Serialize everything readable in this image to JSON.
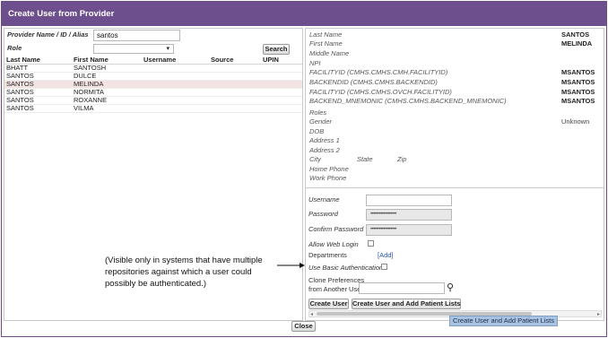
{
  "dialog": {
    "title": "Create User from Provider",
    "close_button": "Close"
  },
  "search": {
    "provider_label": "Provider Name / ID / Alias",
    "provider_value": "santos",
    "role_label": "Role",
    "role_selected": "",
    "search_button": "Search"
  },
  "results": {
    "columns": [
      "Last Name",
      "First Name",
      "Username",
      "Source",
      "UPIN"
    ],
    "rows": [
      {
        "last": "BHATT",
        "first": "SANTOSH",
        "username": "",
        "source": "",
        "upin": ""
      },
      {
        "last": "SANTOS",
        "first": "DULCE",
        "username": "",
        "source": "",
        "upin": ""
      },
      {
        "last": "SANTOS",
        "first": "MELINDA",
        "username": "",
        "source": "",
        "upin": ""
      },
      {
        "last": "SANTOS",
        "first": "NORMITA",
        "username": "",
        "source": "",
        "upin": ""
      },
      {
        "last": "SANTOS",
        "first": "ROXANNE",
        "username": "",
        "source": "",
        "upin": ""
      },
      {
        "last": "SANTOS",
        "first": "VILMA",
        "username": "",
        "source": "",
        "upin": ""
      }
    ],
    "selected_index": 2
  },
  "details": {
    "last_name_label": "Last Name",
    "last_name_value": "SANTOS",
    "first_name_label": "First Name",
    "first_name_value": "MELINDA",
    "middle_name_label": "Middle Name",
    "npi_label": "NPI",
    "facilityid_label": "FACILITYID (CMHS.CMHS.CMH.FACILITYID)",
    "facilityid_value": "MSANTOS",
    "backendid_label": "BACKENDID (CMHS.CMHS.BACKENDID)",
    "backendid_value": "MSANTOS",
    "facilityid2_label": "FACILITYID (CMHS.CMHS.OVCH.FACILITYID)",
    "facilityid2_value": "MSANTOS",
    "mnemonic_label": "BACKEND_MNEMONIC (CMHS.CMHS.BACKEND_MNEMONIC)",
    "mnemonic_value": "MSANTOS",
    "roles_label": "Roles",
    "gender_label": "Gender",
    "gender_value": "Unknown",
    "dob_label": "DOB",
    "address1_label": "Address 1",
    "address2_label": "Address 2",
    "city_label": "City",
    "state_label": "State",
    "zip_label": "Zip",
    "home_phone_label": "Home Phone",
    "work_phone_label": "Work Phone"
  },
  "form": {
    "username_label": "Username",
    "password_label": "Password",
    "password_value": "••••••••••••••••••",
    "confirm_label": "Confirm Password",
    "confirm_value": "••••••••••••••••••",
    "web_login_label": "Allow Web Login",
    "departments_label": "Departments",
    "departments_add": "[Add]",
    "basic_auth_label": "Use Basic Authentication",
    "clone_label_1": "Clone Preferences",
    "clone_label_2": "from Another User",
    "create_user_button": "Create User",
    "create_add_button": "Create User and Add Patient Lists"
  },
  "annotation": {
    "text": "(Visible only in systems that have multiple repositories against which a user could possibly be authenticated.)"
  },
  "tooltip": {
    "text": "Create User and Add Patient Lists"
  }
}
